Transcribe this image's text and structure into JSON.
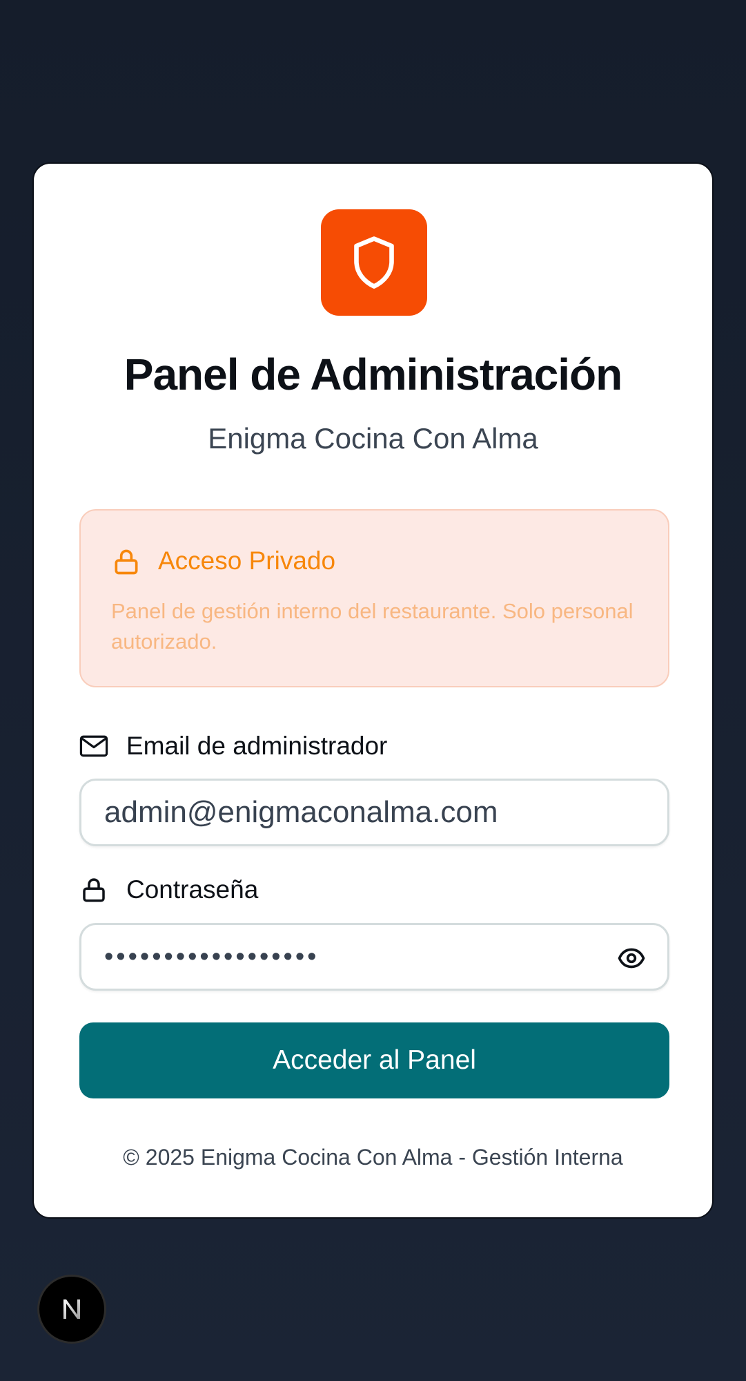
{
  "header": {
    "logo_icon": "shield-icon",
    "title": "Panel de Administración",
    "subtitle": "Enigma Cocina Con Alma"
  },
  "notice": {
    "icon": "lock-icon",
    "title": "Acceso Privado",
    "text": "Panel de gestión interno del restaurante. Solo personal autorizado."
  },
  "form": {
    "email_label": "Email de administrador",
    "email_icon": "mail-icon",
    "email_value": "admin@enigmaconalma.com",
    "password_label": "Contraseña",
    "password_icon": "lock-icon",
    "password_value": "••••••••••••••••••",
    "toggle_icon": "eye-icon",
    "submit_label": "Acceder al Panel"
  },
  "footer": {
    "text": "© 2025 Enigma Cocina Con Alma - Gestión Interna"
  },
  "badge": {
    "letter": "N"
  },
  "colors": {
    "accent": "#f64c04",
    "primary_button": "#036e77",
    "notice_title": "#f7870b",
    "background": "#151d2b"
  }
}
